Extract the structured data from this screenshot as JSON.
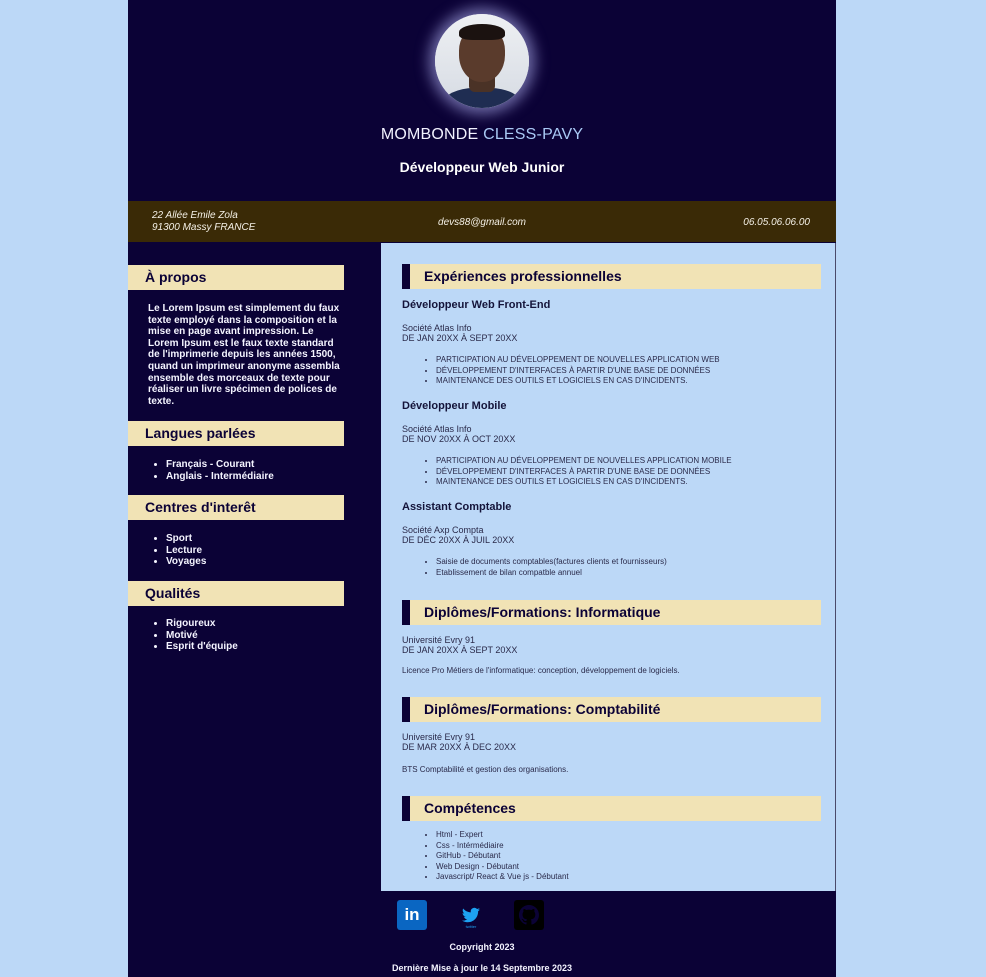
{
  "header": {
    "first_name": "MOMBONDE",
    "last_name": "CLESS-PAVY",
    "job_title": "Développeur Web Junior"
  },
  "contact": {
    "address_line1": "22 Allée Emile Zola",
    "address_line2": "91300 Massy FRANCE",
    "email": "devs88@gmail.com",
    "phone": "06.05.06.06.00"
  },
  "sidebar": {
    "about_title": "À propos",
    "about_text": "Le Lorem Ipsum est simplement du faux texte employé dans la composition et la mise en page avant impression. Le Lorem Ipsum est le faux texte standard de l'imprimerie depuis les années 1500, quand un imprimeur anonyme assembla ensemble des morceaux de texte pour réaliser un livre spécimen de polices de texte.",
    "languages_title": "Langues parlées",
    "languages": [
      "Français - Courant",
      "Anglais - Intermédiaire"
    ],
    "interests_title": "Centres d'interêt",
    "interests": [
      "Sport",
      "Lecture",
      "Voyages"
    ],
    "qualities_title": "Qualités",
    "qualities": [
      "Rigoureux",
      "Motivé",
      "Esprit d'équipe"
    ]
  },
  "experience": {
    "title": "Expériences professionnelles",
    "jobs": [
      {
        "title": "Développeur Web Front-End",
        "company": "Société Atlas Info",
        "dates": "DE JAN 20XX À SEPT 20XX",
        "bullets": [
          "PARTICIPATION AU DÉVELOPPEMENT DE NOUVELLES APPLICATION WEB",
          "DÉVELOPPEMENT D'INTERFACES À PARTIR D'UNE BASE DE DONNÉES",
          "MAINTENANCE DES OUTILS ET LOGICIELS EN CAS D'INCIDENTS."
        ]
      },
      {
        "title": "Développeur Mobile",
        "company": "Société Atlas Info",
        "dates": "DE NOV 20XX À OCT 20XX",
        "bullets": [
          "PARTICIPATION AU DÉVELOPPEMENT DE NOUVELLES APPLICATION MOBILE",
          "DÉVELOPPEMENT D'INTERFACES À PARTIR D'UNE BASE DE DONNÉES",
          "MAINTENANCE DES OUTILS ET LOGICIELS EN CAS D'INCIDENTS."
        ]
      },
      {
        "title": "Assistant Comptable",
        "company": "Société Axp Compta",
        "dates": "DE DÉC 20XX À JUIL 20XX",
        "bullets": [
          "Saisie de documents comptables(factures clients et fournisseurs)",
          "Etablissement de bilan compatble annuel"
        ]
      }
    ]
  },
  "diploma_it": {
    "title": "Diplômes/Formations: Informatique",
    "school": "Université Evry 91",
    "dates": "DE JAN 20XX À SEPT 20XX",
    "description": "Licence Pro Métiers de l'informatique: conception, développement de logiciels."
  },
  "diploma_accounting": {
    "title": "Diplômes/Formations: Comptabilité",
    "school": "Université Evry 91",
    "dates": "DE MAR 20XX À DEC 20XX",
    "description": "BTS Comptabilité et gestion des organisations."
  },
  "skills": {
    "title": "Compétences",
    "items": [
      "Html - Expert",
      "Css - Intérmédiaire",
      "GitHub - Débutant",
      "Web Design - Débutant",
      "Javascript/ React & Vue js - Débutant"
    ]
  },
  "footer": {
    "linkedin_label": "in",
    "twitter_label": "twitter",
    "copyright": "Copyright 2023",
    "updated": "Dernière Mise à jour le 14 Septembre 2023"
  },
  "colors": {
    "page_bg": "#bcd8f7",
    "dark_navy": "#0b0236",
    "contact_bar": "#3a2a06",
    "title_band": "#f1e3b5",
    "accent_name": "#a9c9f5"
  }
}
